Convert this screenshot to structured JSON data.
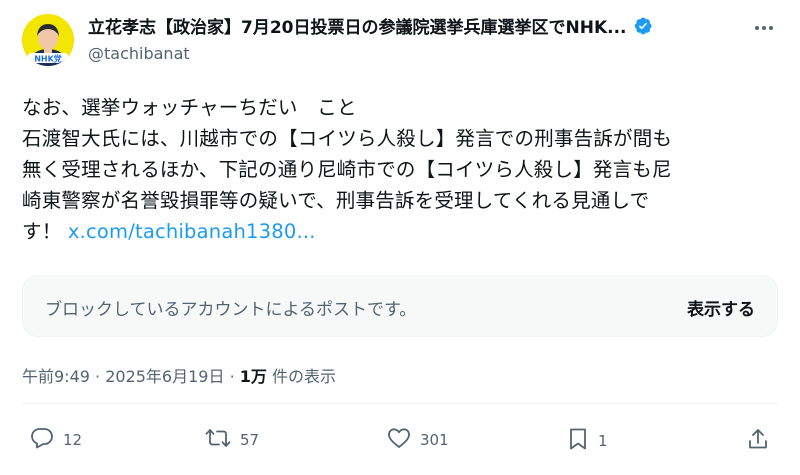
{
  "header": {
    "display_name": "立花孝志【政治家】7月20日投票日の参議院選挙兵庫選挙区でNHK...",
    "handle": "@tachibanat",
    "avatar_badge": "NHK党"
  },
  "tweet": {
    "lines": [
      "なお、選挙ウォッチャーちだい　こと",
      "石渡智大氏には、川越市での【コイツら人殺し】発言での刑事告訴が間も",
      "無く受理されるほか、下記の通り尼崎市での【コイツら人殺し】発言も尼",
      "崎東警察が名誉毀損罪等の疑いで、刑事告訴を受理してくれる見通しで"
    ],
    "last_line_prefix": "す！ ",
    "link": "x.com/tachibanah1380..."
  },
  "blocked_card": {
    "message": "ブロックしているアカウントによるポストです。",
    "button_label": "表示する"
  },
  "meta": {
    "time": "午前9:49",
    "date": "2025年6月19日",
    "views_count": "1万",
    "views_label": " 件の表示"
  },
  "actions": {
    "replies": "12",
    "reposts": "57",
    "likes": "301",
    "bookmarks": "1"
  },
  "colors": {
    "accent": "#1d9bf0",
    "secondary_text": "#536471",
    "avatar_bg": "#f2e600"
  }
}
